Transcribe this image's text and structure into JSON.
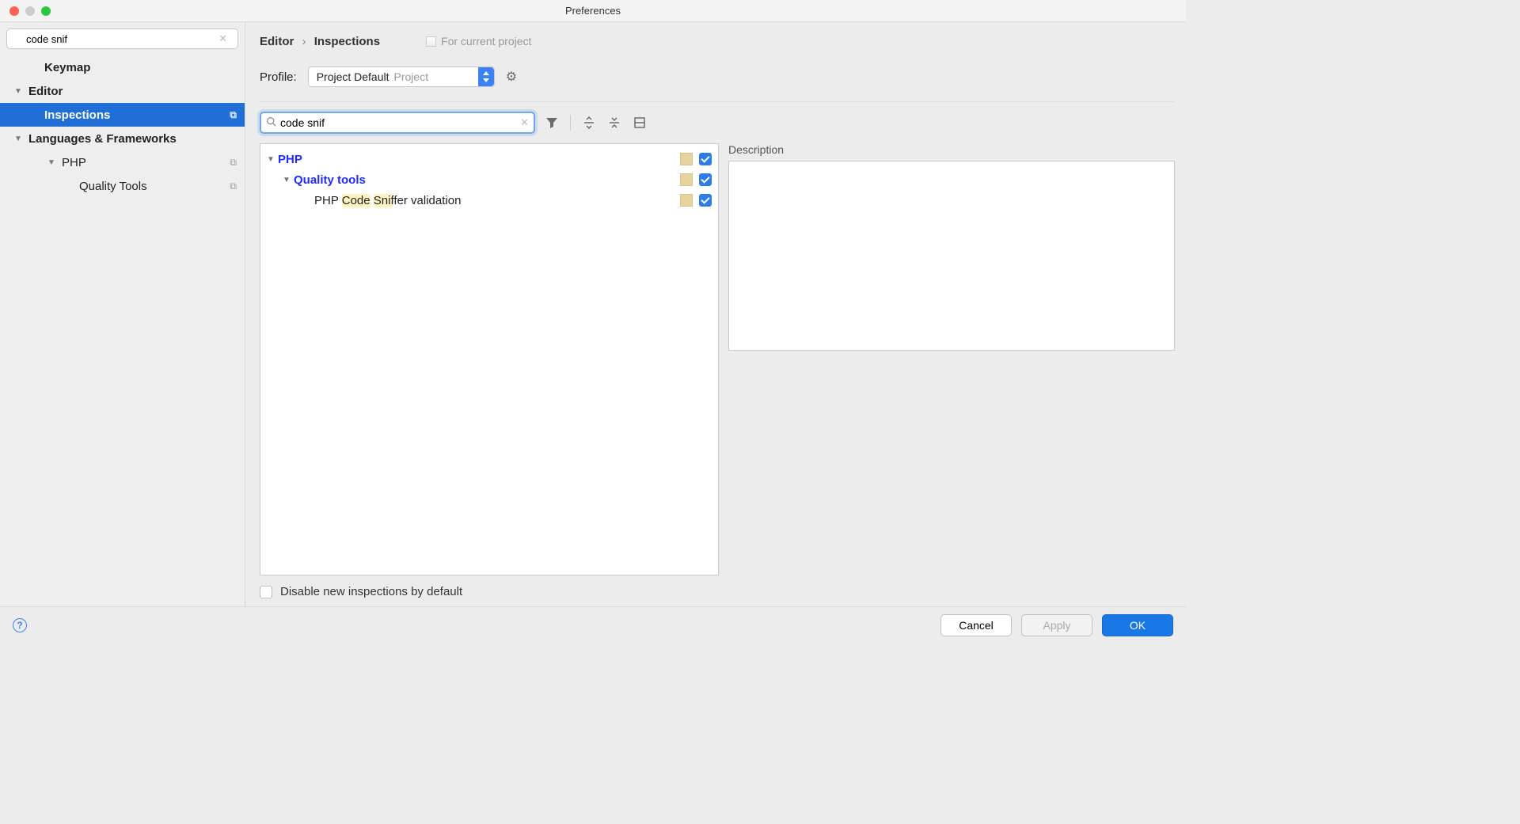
{
  "window": {
    "title": "Preferences"
  },
  "sidebar": {
    "search_value": "code snif",
    "items": [
      {
        "label": "Keymap",
        "selected": false,
        "expandable": false,
        "level": 2
      },
      {
        "label": "Editor",
        "selected": false,
        "expandable": true,
        "level": 1
      },
      {
        "label": "Inspections",
        "selected": true,
        "expandable": false,
        "level": 2,
        "has_copy": true
      },
      {
        "label": "Languages & Frameworks",
        "selected": false,
        "expandable": true,
        "level": 1
      },
      {
        "label": "PHP",
        "selected": false,
        "expandable": true,
        "level": 3,
        "has_copy": true
      },
      {
        "label": "Quality Tools",
        "selected": false,
        "expandable": false,
        "level": 4,
        "has_copy": true
      }
    ]
  },
  "breadcrumb": {
    "parent": "Editor",
    "current": "Inspections"
  },
  "scope_hint": "For current project",
  "profile": {
    "label": "Profile:",
    "selected": "Project Default",
    "scope": "Project"
  },
  "inspection_search_value": "code snif",
  "inspections": {
    "root": {
      "label": "PHP",
      "checked": true
    },
    "group": {
      "label": "Quality tools",
      "checked": true
    },
    "item": {
      "prefix": "PHP ",
      "hl1": "Code",
      "mid": " ",
      "hl2": "Snif",
      "suffix": "fer validation",
      "checked": true
    }
  },
  "description": {
    "title": "Description"
  },
  "disable_label": "Disable new inspections by default",
  "buttons": {
    "cancel": "Cancel",
    "apply": "Apply",
    "ok": "OK"
  }
}
